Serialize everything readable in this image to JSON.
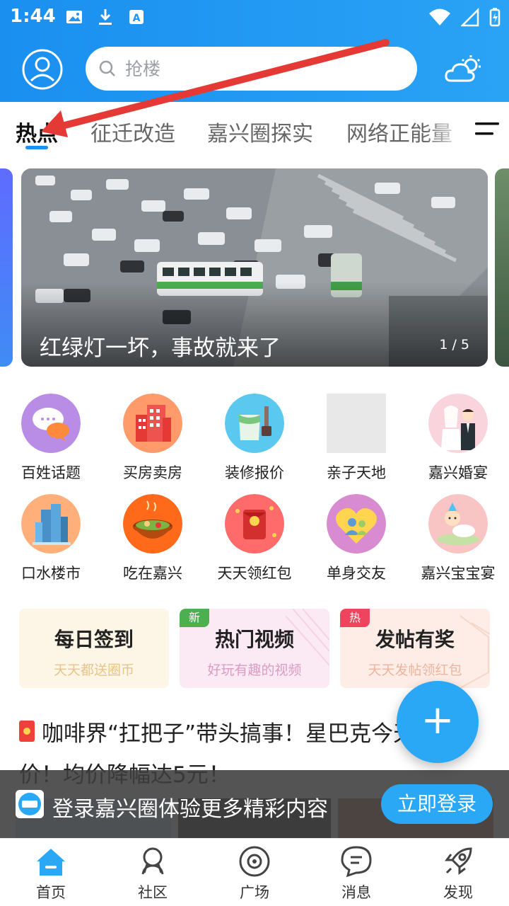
{
  "status_bar": {
    "time": "1:44"
  },
  "search": {
    "placeholder": "抢楼"
  },
  "tabs": [
    {
      "label": "热点",
      "active": true
    },
    {
      "label": "征迁改造",
      "active": false
    },
    {
      "label": "嘉兴圈探实",
      "active": false
    },
    {
      "label": "网络正能量",
      "active": false
    }
  ],
  "banner": {
    "title": "红绿灯一坏，事故就来了",
    "pager": "1 / 5"
  },
  "grid": [
    {
      "label": "百姓话题",
      "icon": "chat-bubbles-icon"
    },
    {
      "label": "买房卖房",
      "icon": "building-icon"
    },
    {
      "label": "装修报价",
      "icon": "paint-bucket-icon"
    },
    {
      "label": "亲子天地",
      "icon": "placeholder-icon"
    },
    {
      "label": "嘉兴婚宴",
      "icon": "bride-groom-icon"
    },
    {
      "label": "口水楼市",
      "icon": "skyscraper-icon"
    },
    {
      "label": "吃在嘉兴",
      "icon": "hotpot-icon"
    },
    {
      "label": "天天领红包",
      "icon": "red-envelope-icon"
    },
    {
      "label": "单身交友",
      "icon": "heart-couple-icon"
    },
    {
      "label": "嘉兴宝宝宴",
      "icon": "baby-icon"
    }
  ],
  "cards": [
    {
      "title": "每日签到",
      "subtitle": "天天都送圈币",
      "badge": ""
    },
    {
      "title": "热门视频",
      "subtitle": "好玩有趣的视频",
      "badge": "新"
    },
    {
      "title": "发帖有奖",
      "subtitle": "天天发帖领红包",
      "badge": "热"
    }
  ],
  "article": {
    "title": "咖啡界“扛把子”带头搞事！星巴克今天起降价！均价降幅达5元！"
  },
  "fab": {
    "label": "+"
  },
  "login_bar": {
    "text": "登录嘉兴圈体验更多精彩内容",
    "button": "立即登录"
  },
  "bottom_nav": [
    {
      "label": "首页",
      "icon": "home-icon",
      "active": true
    },
    {
      "label": "社区",
      "icon": "community-icon",
      "active": false
    },
    {
      "label": "广场",
      "icon": "plaza-icon",
      "active": false
    },
    {
      "label": "消息",
      "icon": "message-icon",
      "active": false
    },
    {
      "label": "发现",
      "icon": "rocket-icon",
      "active": false
    }
  ],
  "colors": {
    "brand": "#1e90f0",
    "accent": "#2aa8f5",
    "annotation": "#e53935"
  }
}
